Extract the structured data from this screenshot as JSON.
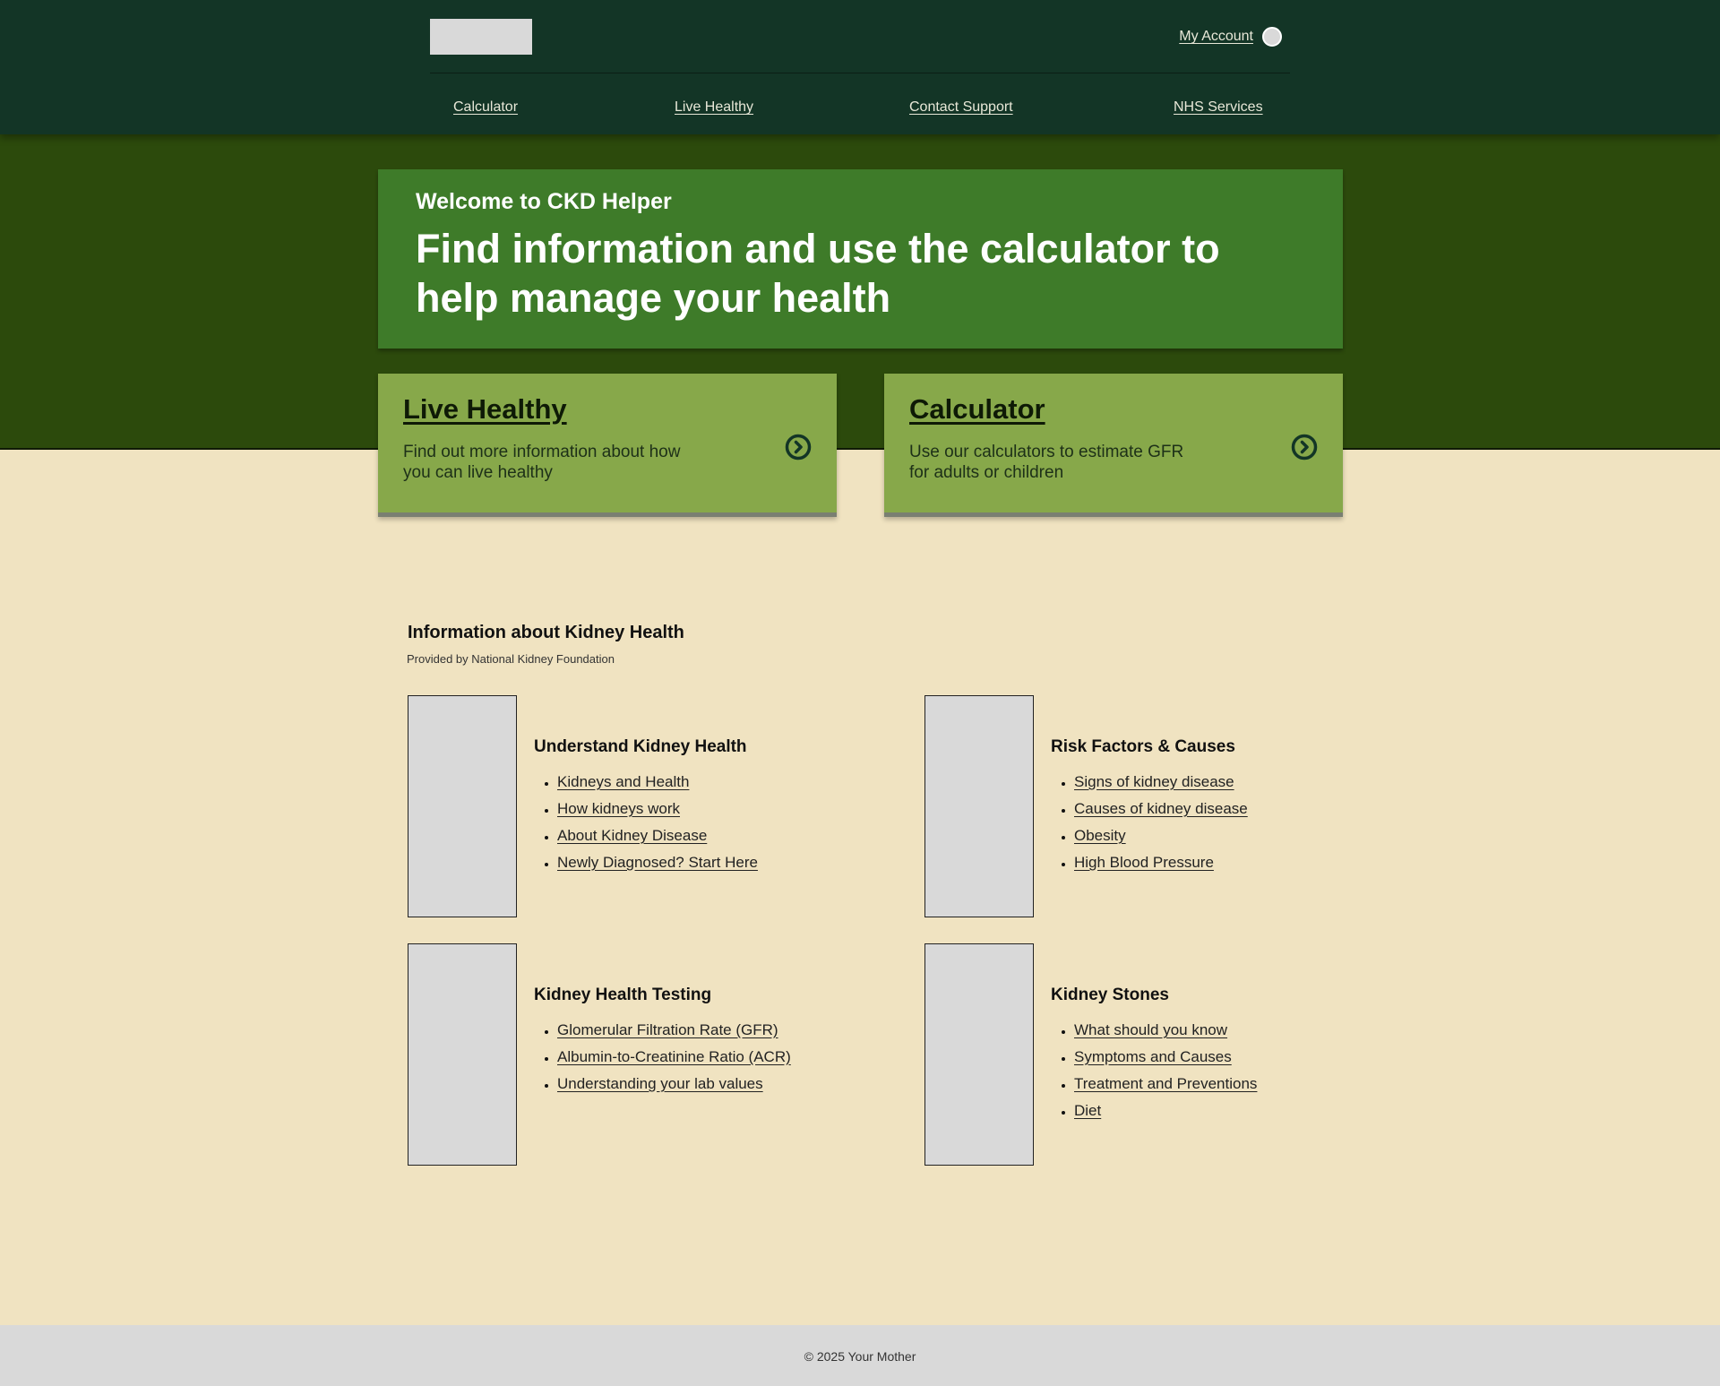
{
  "colors": {
    "header_bg": "#133526",
    "hero_band_bg": "#2c4a0c",
    "welcome_panel_bg": "#3e7b29",
    "card_bg": "#87a84a",
    "page_bg": "#f0e3c1",
    "footer_bg": "#d9d9d9"
  },
  "header": {
    "logo_icon": "logo-placeholder",
    "account_label": "My Account",
    "avatar_icon": "user-avatar-icon",
    "nav": [
      {
        "label": "Calculator"
      },
      {
        "label": "Live Healthy"
      },
      {
        "label": "Contact Support"
      },
      {
        "label": "NHS Services"
      }
    ]
  },
  "hero": {
    "subtitle": "Welcome to CKD Helper",
    "title": "Find information and use the calculator to help manage your health"
  },
  "cards": [
    {
      "title": "Live Healthy",
      "description": "Find out more information about how you can live healthy",
      "icon": "chevron-right-circle-icon"
    },
    {
      "title": "Calculator",
      "description": "Use our calculators to estimate GFR for adults or children",
      "icon": "chevron-right-circle-icon"
    }
  ],
  "info": {
    "heading": "Information about Kidney Health",
    "source": "Provided by National Kidney Foundation",
    "topics": [
      {
        "title": "Understand Kidney Health",
        "links": [
          "Kidneys and Health",
          "How kidneys work",
          "About Kidney Disease",
          "Newly Diagnosed? Start Here"
        ]
      },
      {
        "title": "Risk Factors & Causes",
        "links": [
          "Signs of kidney disease",
          "Causes of kidney disease",
          "Obesity",
          "High Blood Pressure"
        ]
      },
      {
        "title": "Kidney Health Testing",
        "links": [
          "Glomerular Filtration Rate (GFR)",
          "Albumin-to-Creatinine Ratio (ACR)",
          "Understanding your lab values"
        ]
      },
      {
        "title": "Kidney Stones",
        "links": [
          "What should you know",
          "Symptoms and Causes",
          "Treatment and Preventions",
          "Diet"
        ]
      }
    ]
  },
  "footer": {
    "text": "© 2025 Your Mother"
  }
}
